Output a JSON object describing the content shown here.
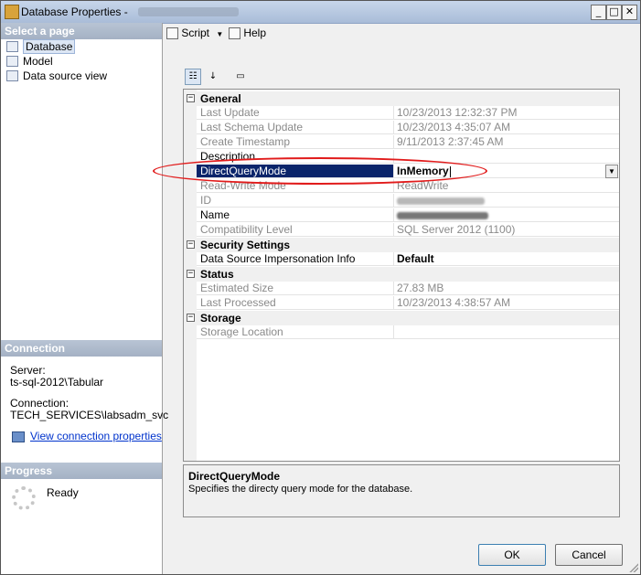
{
  "window": {
    "title": "Database Properties - ",
    "minimize_glyph": "_",
    "maximize_glyph": "□",
    "close_glyph": "✕"
  },
  "left_pane": {
    "select_page_header": "Select a page",
    "pages": [
      {
        "label": "Database",
        "selected": true
      },
      {
        "label": "Model",
        "selected": false
      },
      {
        "label": "Data source view",
        "selected": false
      }
    ],
    "connection_header": "Connection",
    "server_label": "Server:",
    "server_value": "ts-sql-2012\\Tabular",
    "connection_label": "Connection:",
    "connection_value": "TECH_SERVICES\\labsadm_svc",
    "view_connection_link": "View connection properties",
    "progress_header": "Progress",
    "progress_status": "Ready"
  },
  "toolbar": {
    "script_label": "Script",
    "help_label": "Help"
  },
  "property_grid": {
    "categories": [
      {
        "name": "General",
        "properties": [
          {
            "name": "Last Update",
            "value": "10/23/2013 12:32:37 PM"
          },
          {
            "name": "Last Schema Update",
            "value": "10/23/2013 4:35:07 AM"
          },
          {
            "name": "Create Timestamp",
            "value": "9/11/2013 2:37:45 AM"
          },
          {
            "name": "Description",
            "value": ""
          },
          {
            "name": "DirectQueryMode",
            "value": "InMemory"
          },
          {
            "name": "Read-Write Mode",
            "value": "ReadWrite"
          },
          {
            "name": "ID",
            "value": ""
          },
          {
            "name": "Name",
            "value": ""
          },
          {
            "name": "Compatibility Level",
            "value": "SQL Server 2012 (1100)"
          }
        ]
      },
      {
        "name": "Security Settings",
        "properties": [
          {
            "name": "Data Source Impersonation Info",
            "value": "Default"
          }
        ]
      },
      {
        "name": "Status",
        "properties": [
          {
            "name": "Estimated Size",
            "value": "27.83 MB"
          },
          {
            "name": "Last Processed",
            "value": "10/23/2013 4:38:57 AM"
          }
        ]
      },
      {
        "name": "Storage",
        "properties": [
          {
            "name": "Storage Location",
            "value": ""
          }
        ]
      }
    ]
  },
  "description_panel": {
    "title": "DirectQueryMode",
    "text": "Specifies the directy query mode for the database."
  },
  "buttons": {
    "ok": "OK",
    "cancel": "Cancel"
  },
  "colors": {
    "selection": "#0a246a",
    "annotation": "#e11b1b",
    "link": "#0033cc"
  }
}
